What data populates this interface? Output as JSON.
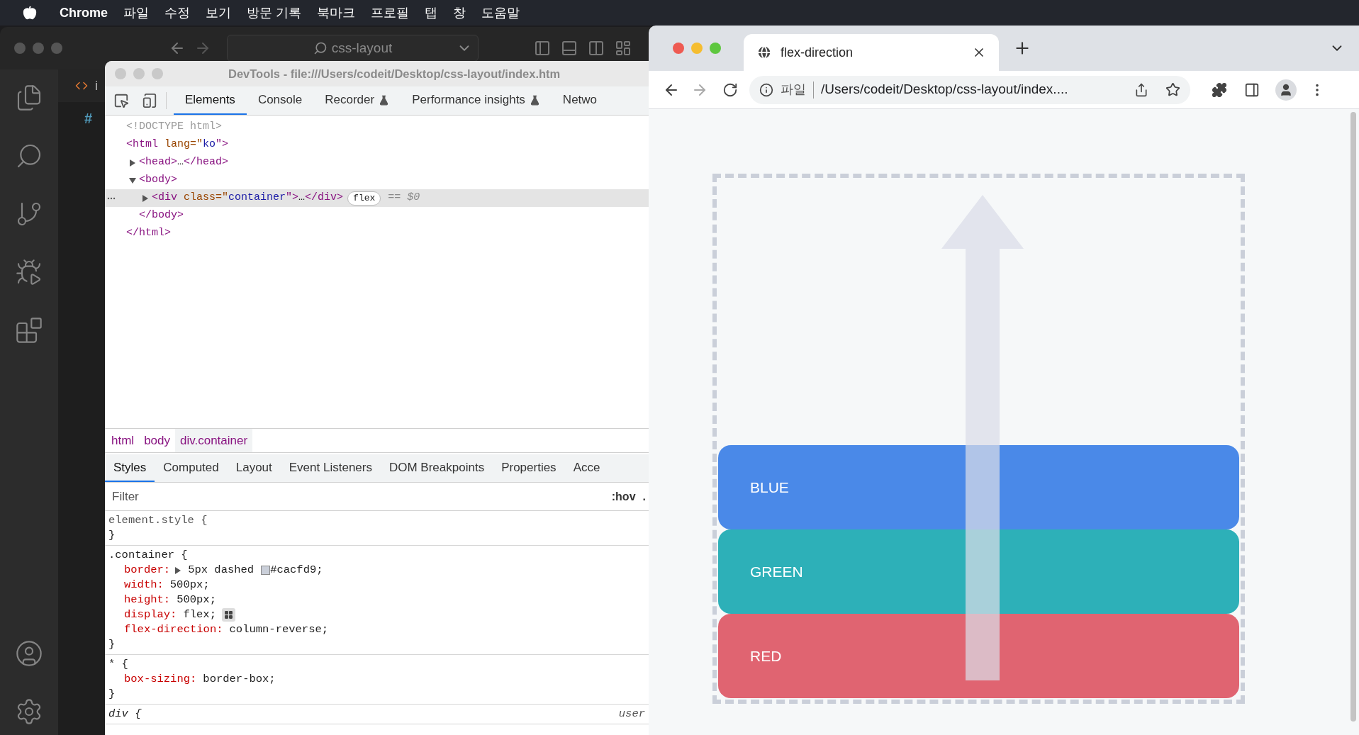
{
  "menu_bar": {
    "app": "Chrome",
    "items": [
      "파일",
      "수정",
      "보기",
      "방문 기록",
      "북마크",
      "프로필",
      "탭",
      "창",
      "도움말"
    ]
  },
  "vscode": {
    "search": "css-layout",
    "tab_label": "i",
    "file_mark": "#"
  },
  "devtools": {
    "title": "DevTools - file:///Users/codeit/Desktop/css-layout/index.htm",
    "tabs": [
      {
        "label": "Elements",
        "selected": true,
        "experimental": false
      },
      {
        "label": "Console",
        "selected": false,
        "experimental": false
      },
      {
        "label": "Recorder",
        "selected": false,
        "experimental": true
      },
      {
        "label": "Performance insights",
        "selected": false,
        "experimental": true
      },
      {
        "label": "Netwo",
        "selected": false,
        "experimental": false
      }
    ],
    "dom": [
      {
        "tokens": [
          {
            "kind": "doctype",
            "text": "<!DOCTYPE html>"
          }
        ],
        "selected": false
      },
      {
        "tokens": [
          {
            "kind": "tag",
            "text": "<html"
          },
          {
            "kind": "attr",
            "text": " lang=\""
          },
          {
            "kind": "value",
            "text": "ko"
          },
          {
            "kind": "tag",
            "text": "\">"
          }
        ],
        "selected": false,
        "close": [
          {
            "kind": "tag",
            "text": "</html>"
          }
        ],
        "children": [
          {
            "tokens": [
              {
                "kind": "tag",
                "text": "<head>"
              },
              {
                "kind": "plain",
                "text": "…"
              },
              {
                "kind": "tag",
                "text": "</head>"
              }
            ],
            "expanded": false,
            "selected": false
          },
          {
            "tokens": [
              {
                "kind": "tag",
                "text": "<body>"
              }
            ],
            "expanded": true,
            "selected": false,
            "close": [
              {
                "kind": "tag",
                "text": "</body>"
              }
            ],
            "children": [
              {
                "tokens": [
                  {
                    "kind": "tag",
                    "text": "<div"
                  },
                  {
                    "kind": "attr",
                    "text": " class=\""
                  },
                  {
                    "kind": "value",
                    "text": "container"
                  },
                  {
                    "kind": "tag",
                    "text": "\">"
                  },
                  {
                    "kind": "plain",
                    "text": "…"
                  },
                  {
                    "kind": "tag",
                    "text": "</div>"
                  }
                ],
                "expanded": false,
                "selected": true,
                "badge": "flex",
                "suffix": "== $0"
              }
            ]
          }
        ]
      }
    ],
    "breadcrumbs": [
      {
        "label": "html",
        "selected": false
      },
      {
        "label": "body",
        "selected": false
      },
      {
        "label": "div.container",
        "selected": true
      }
    ],
    "subtabs": [
      {
        "label": "Styles",
        "selected": true
      },
      {
        "label": "Computed",
        "selected": false
      },
      {
        "label": "Layout",
        "selected": false
      },
      {
        "label": "Event Listeners",
        "selected": false
      },
      {
        "label": "DOM Breakpoints",
        "selected": false
      },
      {
        "label": "Properties",
        "selected": false
      },
      {
        "label": "Acce",
        "selected": false
      }
    ],
    "filter": {
      "placeholder": "Filter"
    },
    "hov": ":hov",
    "cls": ".",
    "rules": [
      {
        "kind": "inline",
        "selector": "element.style {",
        "close": "}"
      },
      {
        "kind": "author",
        "selector": ".container {",
        "close": "}",
        "props": [
          {
            "name": "border:",
            "value": "5px dashed",
            "expandable": true,
            "swatch": true,
            "swatch_value": "#cacfd9;"
          },
          {
            "name": "width:",
            "value": "500px;",
            "expandable": false
          },
          {
            "name": "height:",
            "value": "500px;",
            "expandable": false
          },
          {
            "name": "display:",
            "value": "flex;",
            "expandable": false,
            "flex_editor": true
          },
          {
            "name": "flex-direction:",
            "value": "column-reverse;",
            "expandable": false
          }
        ]
      },
      {
        "kind": "author",
        "selector": "* {",
        "close": "}",
        "props": [
          {
            "name": "box-sizing:",
            "value": "border-box;",
            "expandable": false
          }
        ]
      },
      {
        "kind": "user_agent",
        "selector": "div {",
        "source": "user"
      }
    ]
  },
  "browser": {
    "tab": {
      "title": "flex-direction"
    },
    "address": {
      "scheme": "파일",
      "url": "/Users/codeit/Desktop/css-layout/index...."
    },
    "items": [
      {
        "label": "BLUE",
        "color": "#4a89e8"
      },
      {
        "label": "GREEN",
        "color": "#2db0b8"
      },
      {
        "label": "RED",
        "color": "#e06471"
      }
    ]
  }
}
